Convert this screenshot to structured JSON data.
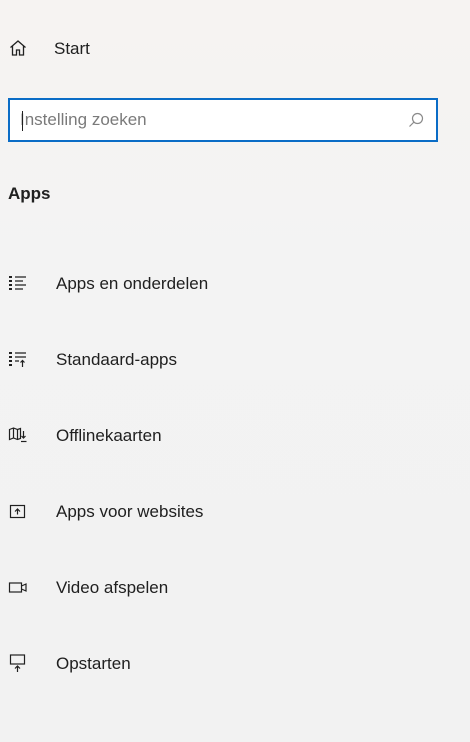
{
  "header": {
    "home_label": "Start",
    "home_icon": "home-icon"
  },
  "search": {
    "placeholder": "Instelling zoeken",
    "value": "",
    "icon": "search-icon",
    "focus_border_color": "#0a6cc6"
  },
  "section": {
    "title": "Apps"
  },
  "nav": {
    "items": [
      {
        "label": "Apps en onderdelen",
        "icon": "apps-features-icon"
      },
      {
        "label": "Standaard-apps",
        "icon": "default-apps-icon"
      },
      {
        "label": "Offlinekaarten",
        "icon": "offline-maps-icon"
      },
      {
        "label": "Apps voor websites",
        "icon": "apps-for-websites-icon"
      },
      {
        "label": "Video afspelen",
        "icon": "video-playback-icon"
      },
      {
        "label": "Opstarten",
        "icon": "startup-icon"
      }
    ]
  }
}
